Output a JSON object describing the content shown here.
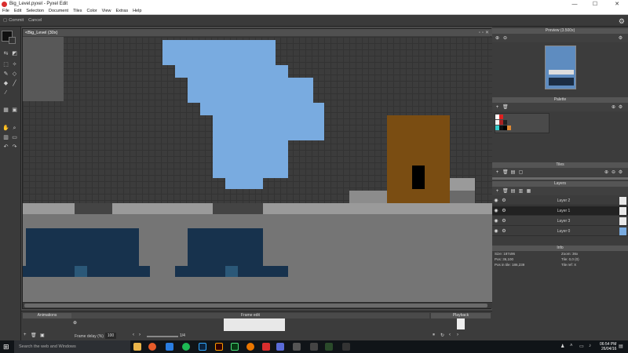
{
  "window": {
    "title": "Big_Level.pyxel - Pyxel Edit",
    "min": "—",
    "max": "☐",
    "close": "✕"
  },
  "menu": [
    "File",
    "Edit",
    "Selection",
    "Document",
    "Tiles",
    "Color",
    "View",
    "Extras",
    "Help"
  ],
  "toolbar": {
    "commit": "Commit",
    "cancel": "Cancel"
  },
  "document": {
    "tab_label": "<Big_Level (30x)"
  },
  "canvas": {
    "colors": {
      "light_blue": "#79abe0",
      "navy": "#17324d",
      "steel": "#2b5878",
      "gray": "#757575",
      "light_gray": "#9a9a9a",
      "dark_gray": "#585858",
      "darker": "#444444",
      "brown": "#7a4d12",
      "black": "#000000"
    }
  },
  "panels": {
    "preview": {
      "title": "Preview (3.500x)"
    },
    "palette": {
      "title": "Palette",
      "colors": [
        "#ffffff",
        "#e02020",
        "#222222",
        "#33cccc",
        "#dd8833",
        "#f0f0f0",
        "#111111",
        "#aa2222",
        "#000000"
      ]
    },
    "tiles": {
      "title": "Tiles"
    },
    "layers": {
      "title": "Layers",
      "items": [
        {
          "name": "Layer 2"
        },
        {
          "name": "Layer 1"
        },
        {
          "name": "Layer 3"
        },
        {
          "name": "Layer 0"
        }
      ]
    },
    "info": {
      "title": "Info",
      "size": "Size: 187x96",
      "zoom": "Zoom: 36x",
      "pos": "Pos: 36,100",
      "tile": "Tile: 0,0 (0)",
      "pos_tile": "Pos in tile: 186,239",
      "tile_ref": "Tile ref: X"
    }
  },
  "bottom": {
    "animations": "Animations",
    "frame_edit": "Frame edit",
    "playback": "Playback",
    "frame_delay_label": "Frame delay (%)",
    "frame_delay_value": "100",
    "frame_count": "1/4"
  },
  "taskbar": {
    "search": "Search the web and Windows",
    "time": "06:54 PM",
    "date": "26/04/16"
  }
}
